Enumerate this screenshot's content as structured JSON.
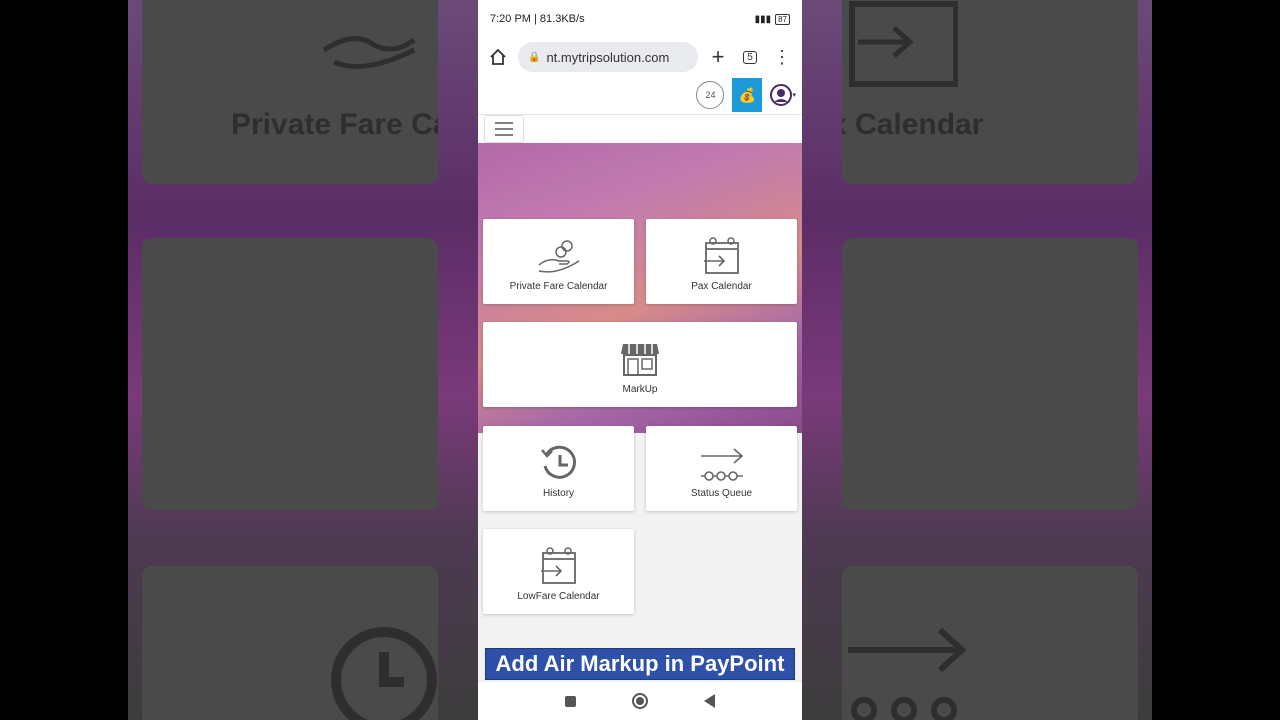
{
  "status_bar": {
    "time_speed": "7:20 PM | 81.3KB/s",
    "battery": "87"
  },
  "browser": {
    "url": "nt.mytripsolution.com",
    "tab_count": "5"
  },
  "header": {
    "support_badge": "24"
  },
  "tiles": [
    {
      "label": "Private Fare Calendar",
      "icon": "coins-hand-icon"
    },
    {
      "label": "Pax Calendar",
      "icon": "calendar-arrow-icon"
    },
    {
      "label": "MarkUp",
      "icon": "store-icon"
    },
    {
      "label": "History",
      "icon": "history-icon"
    },
    {
      "label": "Status Queue",
      "icon": "status-queue-icon"
    },
    {
      "label": "LowFare Calendar",
      "icon": "calendar-arrow-icon"
    }
  ],
  "caption": "Add Air Markup in PayPoint",
  "background": {
    "left_text": "Private Fare Ca",
    "right_text": "x Calendar"
  },
  "colors": {
    "wallet": "#1d9bd9",
    "caption_bg": "#2d51a8"
  }
}
